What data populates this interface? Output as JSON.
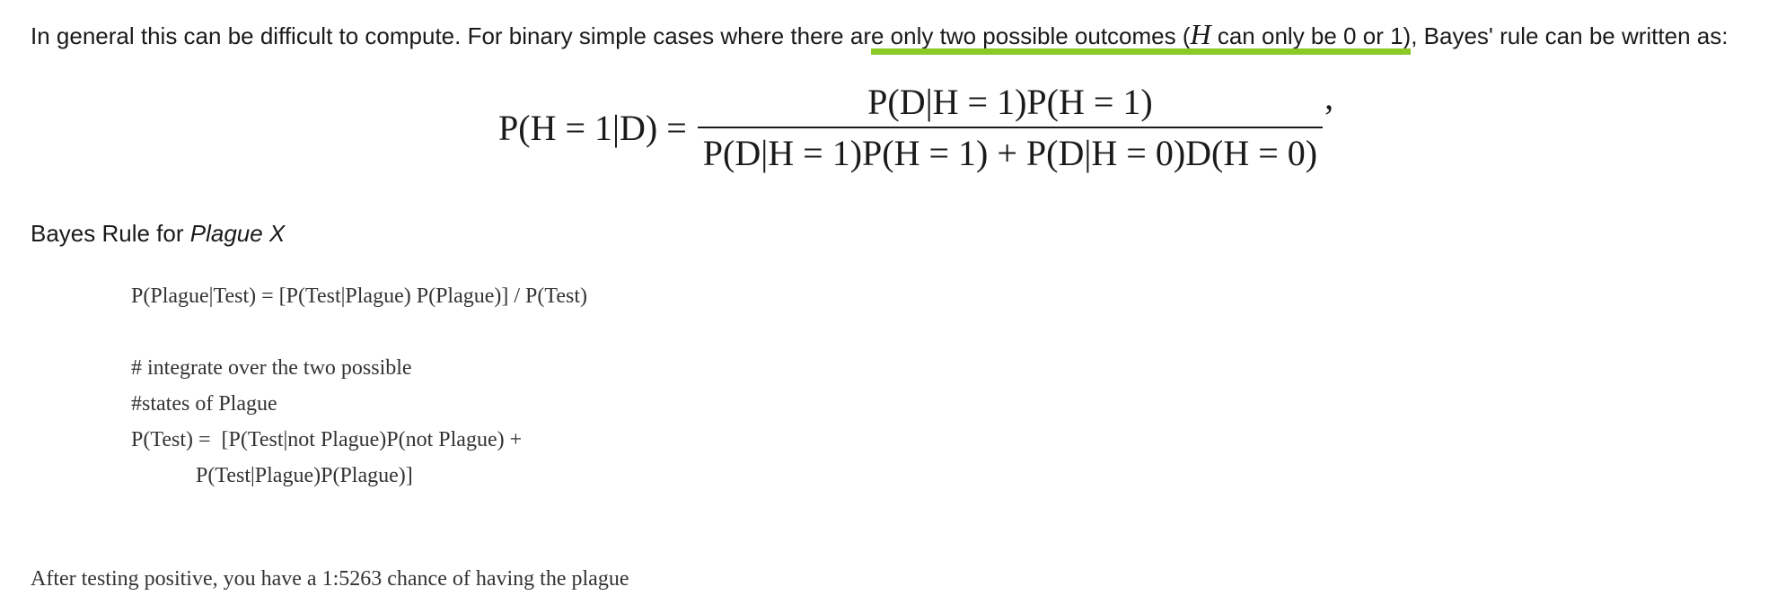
{
  "intro": {
    "part1": "In general this can be difficult to compute. For binary simple cases where there ar",
    "highlighted": "e only two possible outcomes (",
    "math_var": "H",
    "highlighted2": " can only be 0 or 1)",
    "part2": ", Bayes' rule can be written as:"
  },
  "formula": {
    "lhs": "P(H = 1|D) =",
    "numerator": "P(D|H = 1)P(H = 1)",
    "denominator": "P(D|H = 1)P(H = 1) + P(D|H = 0)D(H = 0)",
    "trailing": "’"
  },
  "section": {
    "title_prefix": "Bayes Rule for ",
    "title_italic": "Plague X"
  },
  "code_lines": [
    "P(Plague|Test) = [P(Test|Plague) P(Plague)] / P(Test)",
    "",
    "# integrate over the two possible",
    "#states of Plague",
    "P(Test) =  [P(Test|not Plague)P(not Plague) +",
    "            P(Test|Plague)P(Plague)]"
  ],
  "result": "After testing positive, you have a 1:5263 chance of having the plague"
}
